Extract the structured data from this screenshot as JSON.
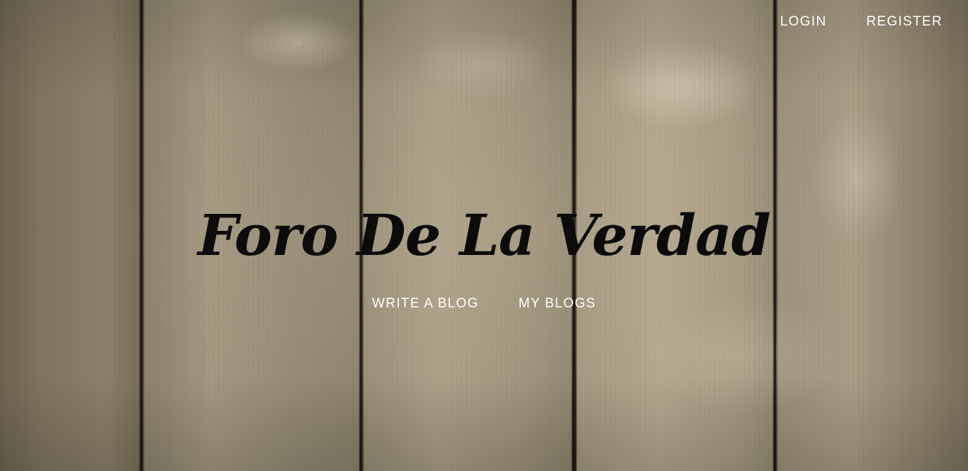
{
  "header": {
    "login_label": "LOGIN",
    "register_label": "REGISTER"
  },
  "hero": {
    "title": "Foro De La Verdad"
  },
  "main_nav": {
    "write_blog_label": "WRITE A BLOG",
    "my_blogs_label": "MY BLOGS"
  },
  "colors": {
    "nav_text": "#ffffff",
    "title_text": "#0b0b0b",
    "background": "wood-planks"
  }
}
